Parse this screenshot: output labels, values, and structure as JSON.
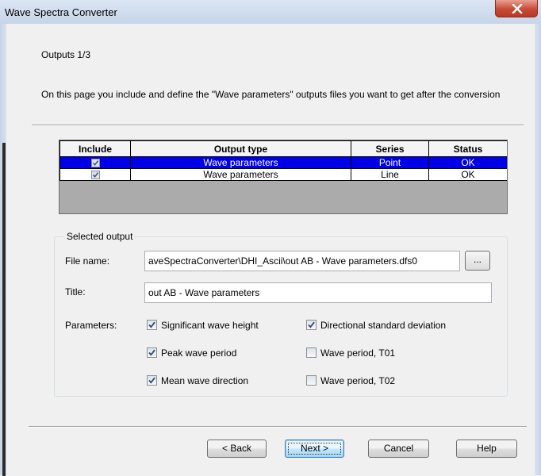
{
  "window": {
    "title": "Wave Spectra Converter"
  },
  "page": {
    "heading": "Outputs 1/3",
    "description": "On this page you include and define the \"Wave parameters\" outputs files you want to get after the conversion"
  },
  "grid": {
    "columns": [
      "Include",
      "Output type",
      "Series",
      "Status"
    ],
    "rows": [
      {
        "include": true,
        "output_type": "Wave parameters",
        "series": "Point",
        "status": "OK",
        "selected": true
      },
      {
        "include": true,
        "output_type": "Wave parameters",
        "series": "Line",
        "status": "OK",
        "selected": false
      }
    ]
  },
  "selected_output": {
    "group_label": "Selected output",
    "file_name_label": "File name:",
    "file_name_value": "aveSpectraConverter\\DHI_Ascii\\out AB - Wave parameters.dfs0",
    "browse_label": "...",
    "title_label": "Title:",
    "title_value": "out AB - Wave parameters",
    "parameters_label": "Parameters:",
    "parameters": [
      {
        "label": "Significant wave height",
        "checked": true
      },
      {
        "label": "Directional standard deviation",
        "checked": true
      },
      {
        "label": "Peak wave period",
        "checked": true
      },
      {
        "label": "Wave period, T01",
        "checked": false
      },
      {
        "label": "Mean wave direction",
        "checked": true
      },
      {
        "label": "Wave period, T02",
        "checked": false
      }
    ]
  },
  "buttons": {
    "back": "< Back",
    "next": "Next >",
    "cancel": "Cancel",
    "help": "Help"
  },
  "icons": {
    "close": "close-icon",
    "check": "checkmark-icon"
  },
  "colors": {
    "selection": "#0000e6",
    "close_button": "#c74a35"
  }
}
